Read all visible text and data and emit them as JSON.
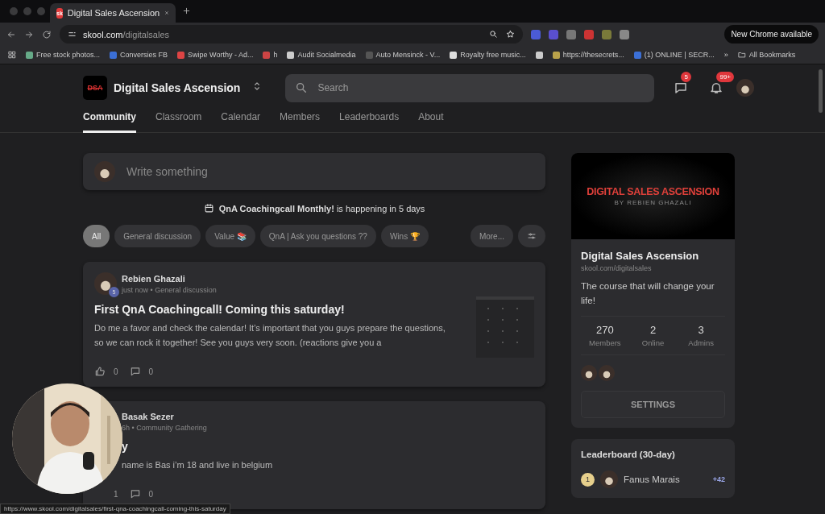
{
  "browser": {
    "tabs": [
      {
        "title": "Digital Sales Ascension",
        "favicon": "sk",
        "selected": true
      }
    ],
    "address": {
      "domain": "skool.com",
      "path": "/digitalsales"
    },
    "update_button": "New Chrome available",
    "bookmarks": [
      {
        "label": "Free stock photos..."
      },
      {
        "label": "Conversies FB"
      },
      {
        "label": "Swipe Worthy - Ad..."
      },
      {
        "label": "h"
      },
      {
        "label": "Audit Socialmedia"
      },
      {
        "label": "Auto Mensinck - V..."
      },
      {
        "label": "Royalty free music..."
      },
      {
        "kind": "icon"
      },
      {
        "label": "https://thesecrets..."
      },
      {
        "label": "(1) ONLINE | SECR..."
      }
    ],
    "overflow": "»",
    "all_bookmarks": "All Bookmarks"
  },
  "header": {
    "logo_text": "DSA",
    "group_name": "Digital Sales Ascension",
    "search_placeholder": "Search",
    "chat_badge": "5",
    "notification_badge": "99+"
  },
  "nav": [
    {
      "label": "Community",
      "selected": true
    },
    {
      "label": "Classroom",
      "selected": false
    },
    {
      "label": "Calendar",
      "selected": false
    },
    {
      "label": "Members",
      "selected": false
    },
    {
      "label": "Leaderboards",
      "selected": false
    },
    {
      "label": "About",
      "selected": false
    }
  ],
  "composer": {
    "placeholder": "Write something"
  },
  "event": "**QnA Coachingcall Monthly!** is happening in 5 days",
  "filters": [
    {
      "label": "All",
      "selected": true
    },
    {
      "label": "General discussion",
      "selected": false
    },
    {
      "label": "Value 📚",
      "selected": false
    },
    {
      "label": "QnA | Ask you questions ??",
      "selected": false
    },
    {
      "label": "Wins 🏆",
      "selected": false
    }
  ],
  "more_filter": "More...",
  "posts": [
    {
      "kind": "full",
      "author": "Rebien Ghazali",
      "level": "5",
      "time": "just now",
      "separator": "•",
      "category": "General discussion",
      "title": "First QnA Coachingcall! Coming this saturday!",
      "body": "Do me a favor and check the calendar! It’s important that you guys prepare the questions, so we can rock it together! See you guys very soon. (reactions give you a",
      "likes": "0",
      "comments": "0",
      "thumbnail": true
    },
    {
      "kind": "covered",
      "author": "Basak Sezer",
      "time": "6h",
      "separator": "•",
      "category": "Community Gathering",
      "title": "y",
      "body": "name is Bas i’m 18 and live in belgium",
      "likes": "1",
      "comments": "0"
    }
  ],
  "about_card": {
    "banner_title": "DIGITAL SALES ASCENSION",
    "banner_subtitle": "BY REBIEN GHAZALI",
    "name": "Digital Sales Ascension",
    "url": "skool.com/digitalsales",
    "description": "The course that will change your life!",
    "stats": [
      {
        "value": "270",
        "label": "Members"
      },
      {
        "value": "2",
        "label": "Online"
      },
      {
        "value": "3",
        "label": "Admins"
      }
    ],
    "settings_button": "SETTINGS"
  },
  "leaderboard": {
    "title": "Leaderboard (30-day)",
    "entries": [
      {
        "rank": "1",
        "name": "Fanus Marais",
        "points": "+42"
      }
    ]
  },
  "status_url": "https://www.skool.com/digitalsales/first-qna-coachingcall-coming-this-saturday"
}
